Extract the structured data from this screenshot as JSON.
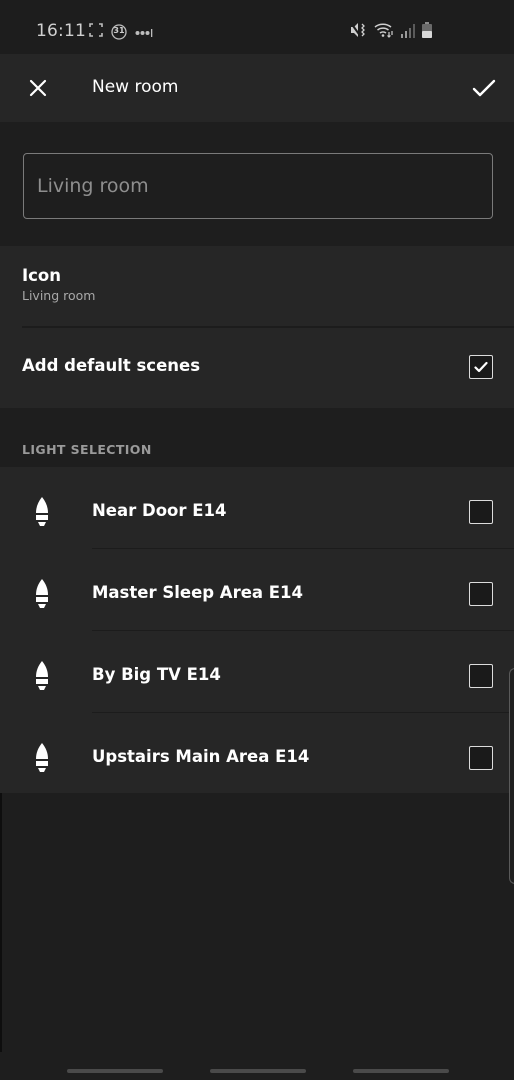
{
  "status_bar": {
    "time": "16:11",
    "left_icons": [
      "screenshot-frame-icon",
      "calendar-31-icon",
      "more-dots-icon"
    ],
    "calendar_day": "31",
    "right_icons": [
      "vibrate-mute-icon",
      "wifi-icon",
      "signal-icon",
      "battery-icon"
    ]
  },
  "toolbar": {
    "title": "New room",
    "close_icon": "close-icon",
    "confirm_icon": "check-icon"
  },
  "name_field": {
    "value": "",
    "placeholder": "Living room"
  },
  "settings": {
    "icon_row": {
      "title": "Icon",
      "subtitle": "Living room"
    },
    "default_scenes": {
      "label": "Add default scenes",
      "checked": true
    }
  },
  "light_selection": {
    "header": "LIGHT SELECTION",
    "lights": [
      {
        "name": "Near Door E14",
        "icon": "candle-bulb-icon",
        "checked": false
      },
      {
        "name": "Master Sleep Area E14",
        "icon": "candle-bulb-icon",
        "checked": false
      },
      {
        "name": "By Big TV E14",
        "icon": "candle-bulb-icon",
        "checked": false
      },
      {
        "name": "Upstairs Main Area E14",
        "icon": "candle-bulb-icon",
        "checked": false
      }
    ]
  },
  "colors": {
    "background": "#1e1e1e",
    "card": "#262626",
    "text_primary": "#ffffff",
    "text_secondary": "#a8a8a8"
  }
}
